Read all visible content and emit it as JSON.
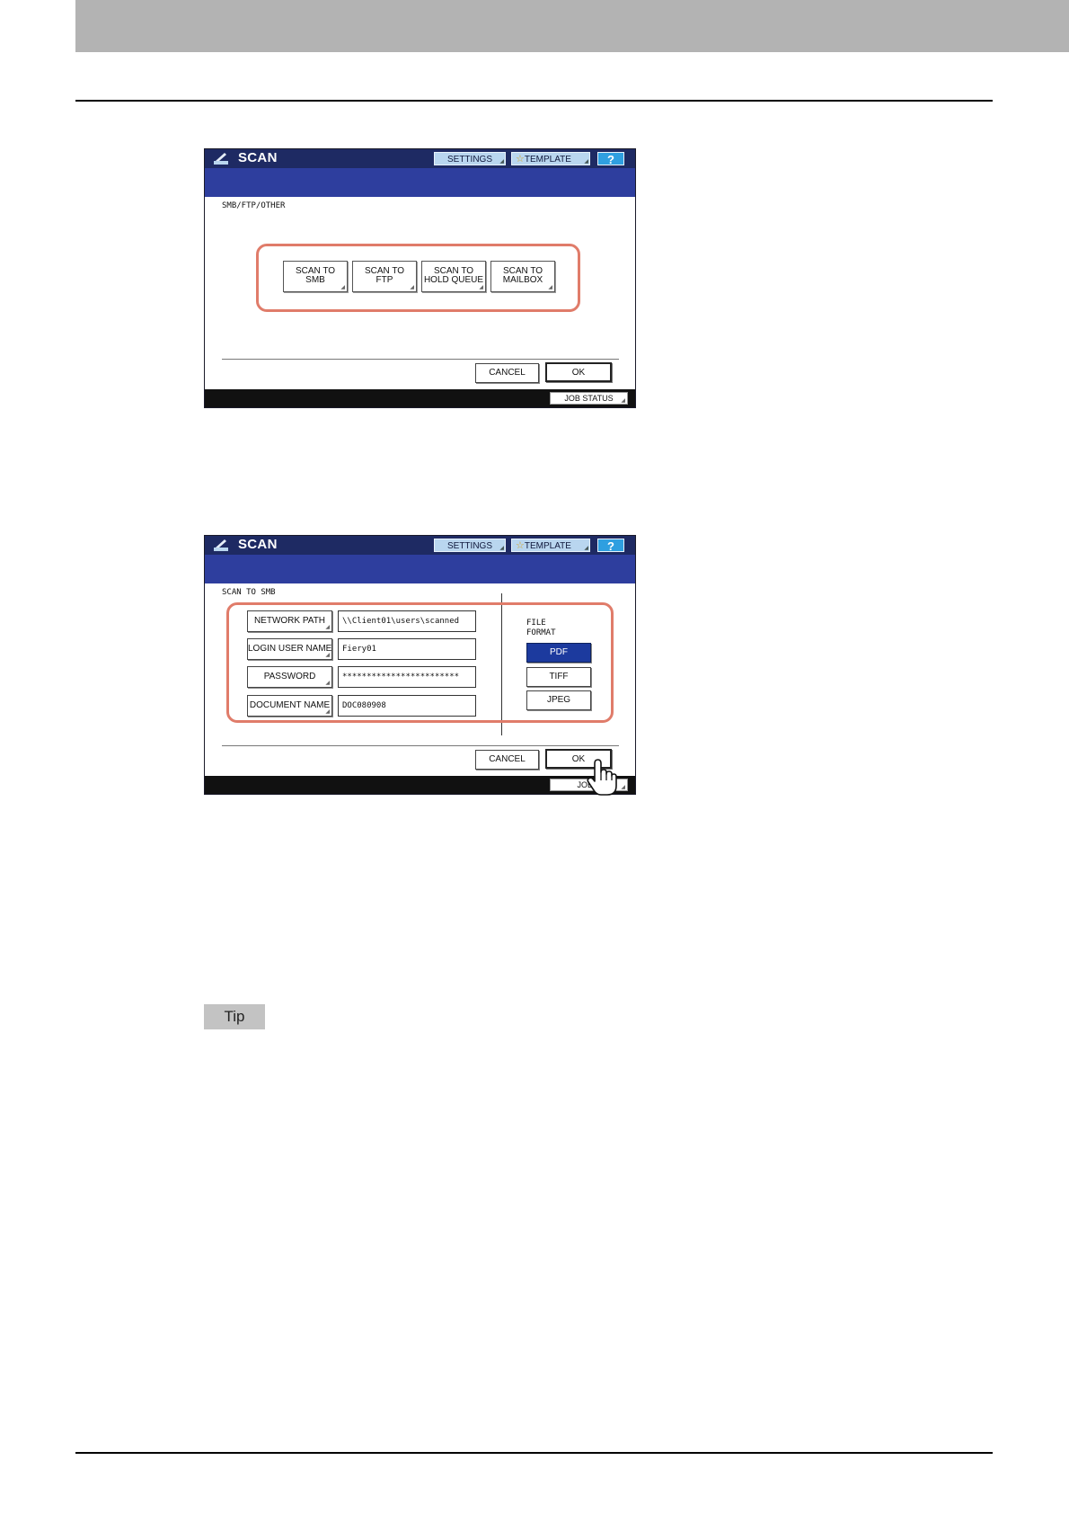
{
  "screen1": {
    "title": "SCAN",
    "settings": "SETTINGS",
    "template": "TEMPLATE",
    "help": "?",
    "area_label": "SMB/FTP/OTHER",
    "buttons": [
      {
        "line1": "SCAN TO",
        "line2": "SMB"
      },
      {
        "line1": "SCAN TO",
        "line2": "FTP"
      },
      {
        "line1": "SCAN TO",
        "line2": "HOLD QUEUE"
      },
      {
        "line1": "SCAN TO",
        "line2": "MAILBOX"
      }
    ],
    "cancel": "CANCEL",
    "ok": "OK",
    "job_status": "JOB STATUS"
  },
  "screen2": {
    "title": "SCAN",
    "settings": "SETTINGS",
    "template": "TEMPLATE",
    "help": "?",
    "area_label": "SCAN TO SMB",
    "fields": [
      {
        "label": "NETWORK PATH",
        "value": "\\\\Client01\\users\\scanned"
      },
      {
        "label": "LOGIN USER NAME",
        "value": "Fiery01"
      },
      {
        "label": "PASSWORD",
        "value": "************************"
      },
      {
        "label": "DOCUMENT NAME",
        "value": "DOC080908"
      }
    ],
    "file_format": {
      "line1": "FILE",
      "line2": "FORMAT"
    },
    "formats": [
      "PDF",
      "TIFF",
      "JPEG"
    ],
    "selected_format": "PDF",
    "cancel": "CANCEL",
    "ok": "OK",
    "job_status": "JOB S"
  },
  "tip": "Tip",
  "colors": {
    "title_bar": "#1e2a63",
    "blue_band": "#2e3e9e",
    "highlight": "#e07c6a",
    "selected": "#1c3a9e",
    "header_band": "#b3b3b3"
  }
}
